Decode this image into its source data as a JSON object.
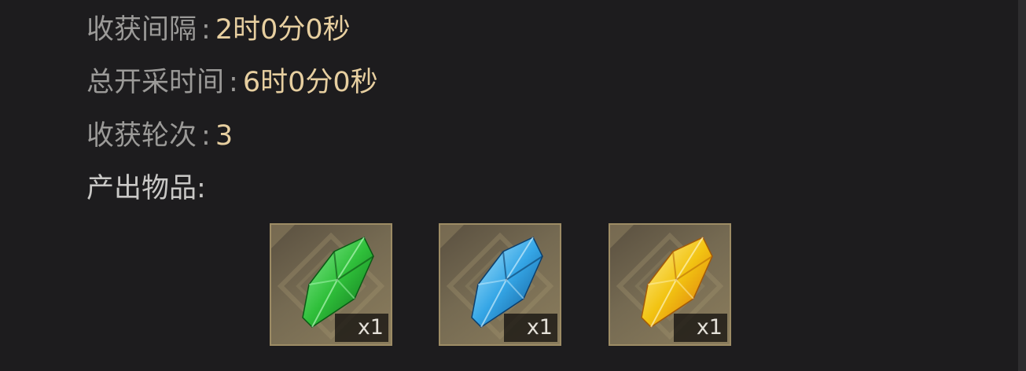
{
  "stats": {
    "harvest_interval": {
      "label": "收获间隔",
      "sep": ":",
      "value": "2时0分0秒"
    },
    "total_mining_time": {
      "label": "总开采时间",
      "sep": ":",
      "value": "6时0分0秒"
    },
    "harvest_rounds": {
      "label": "收获轮次",
      "sep": ":",
      "value": "3"
    }
  },
  "output": {
    "title": "产出物品:",
    "items": [
      {
        "icon": "green-crystal-icon",
        "color": "#2fbf3a",
        "quantity": "x1"
      },
      {
        "icon": "blue-crystal-icon",
        "color": "#35a6e6",
        "quantity": "x1"
      },
      {
        "icon": "yellow-crystal-icon",
        "color": "#f2c312",
        "quantity": "x1"
      }
    ]
  },
  "colors": {
    "background": "#1d1c1e",
    "label": "#9b9a98",
    "value": "#e7cfa0",
    "slot_border": "#9d8c65"
  }
}
